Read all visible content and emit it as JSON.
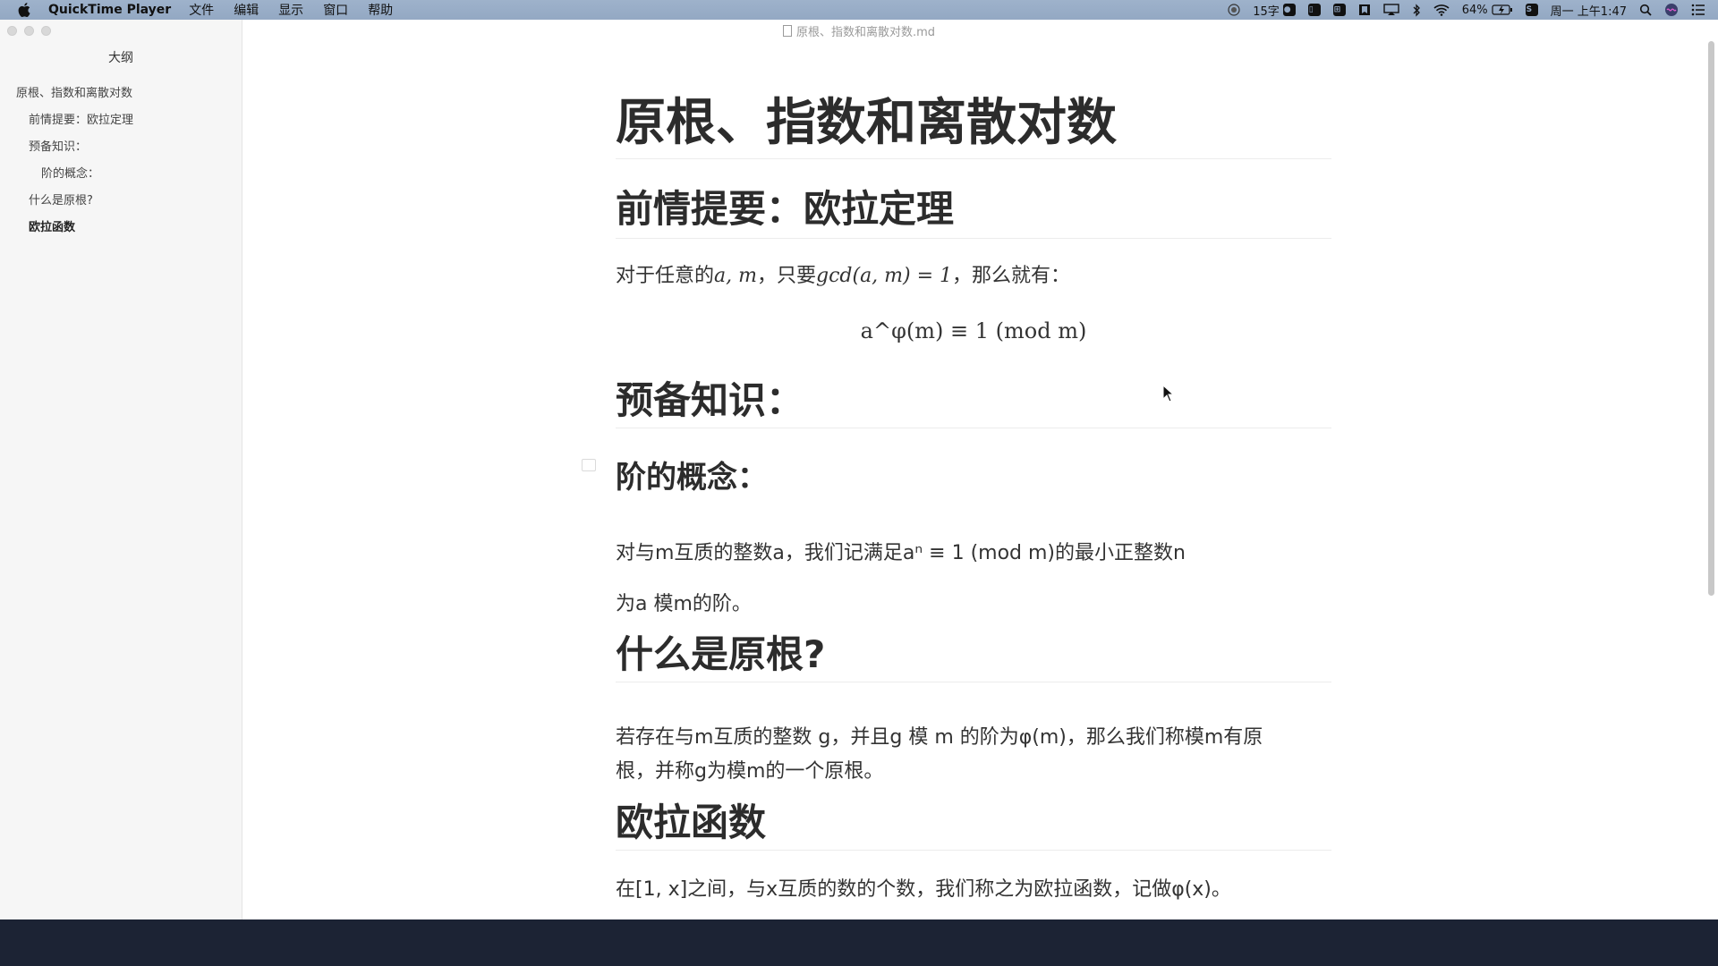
{
  "menubar": {
    "app_name": "QuickTime Player",
    "menus": [
      "文件",
      "编辑",
      "显示",
      "窗口",
      "帮助"
    ],
    "status": {
      "word_count": "15字",
      "battery": "64%",
      "datetime": "周一 上午1:47"
    }
  },
  "window": {
    "doc_title": "原根、指数和离散对数.md"
  },
  "sidebar": {
    "title": "大纲",
    "items": [
      {
        "label": "原根、指数和离散对数",
        "level": 1
      },
      {
        "label": "前情提要：欧拉定理",
        "level": 2
      },
      {
        "label": "预备知识：",
        "level": 2
      },
      {
        "label": "阶的概念：",
        "level": 3
      },
      {
        "label": "什么是原根?",
        "level": 2
      },
      {
        "label": "欧拉函数",
        "level": 2,
        "active": true
      }
    ]
  },
  "document": {
    "h1": "原根、指数和离散对数",
    "sec1": {
      "heading": "前情提要：欧拉定理",
      "p_prefix": "对于任意的",
      "p_math1": "a, m",
      "p_mid": "，只要",
      "p_math2": "gcd(a, m) = 1",
      "p_suffix": "，那么就有：",
      "formula": "a^φ(m) ≡ 1   (mod   m)"
    },
    "sec2": {
      "heading": "预备知识：",
      "sub_heading": "阶的概念：",
      "line1": "对与m互质的整数a，我们记满足aⁿ ≡ 1   (mod   m)的最小正整数n",
      "line2": "为a 模m的阶。"
    },
    "sec3": {
      "heading": "什么是原根?",
      "line1": "若存在与m互质的整数 g，并且g 模 m 的阶为φ(m)，那么我们称模m有原",
      "line2": "根，并称g为模m的一个原根。"
    },
    "sec4": {
      "heading": "欧拉函数",
      "line1": "在[1, x]之间，与x互质的数的个数，我们称之为欧拉函数，记做φ(x)。"
    }
  }
}
